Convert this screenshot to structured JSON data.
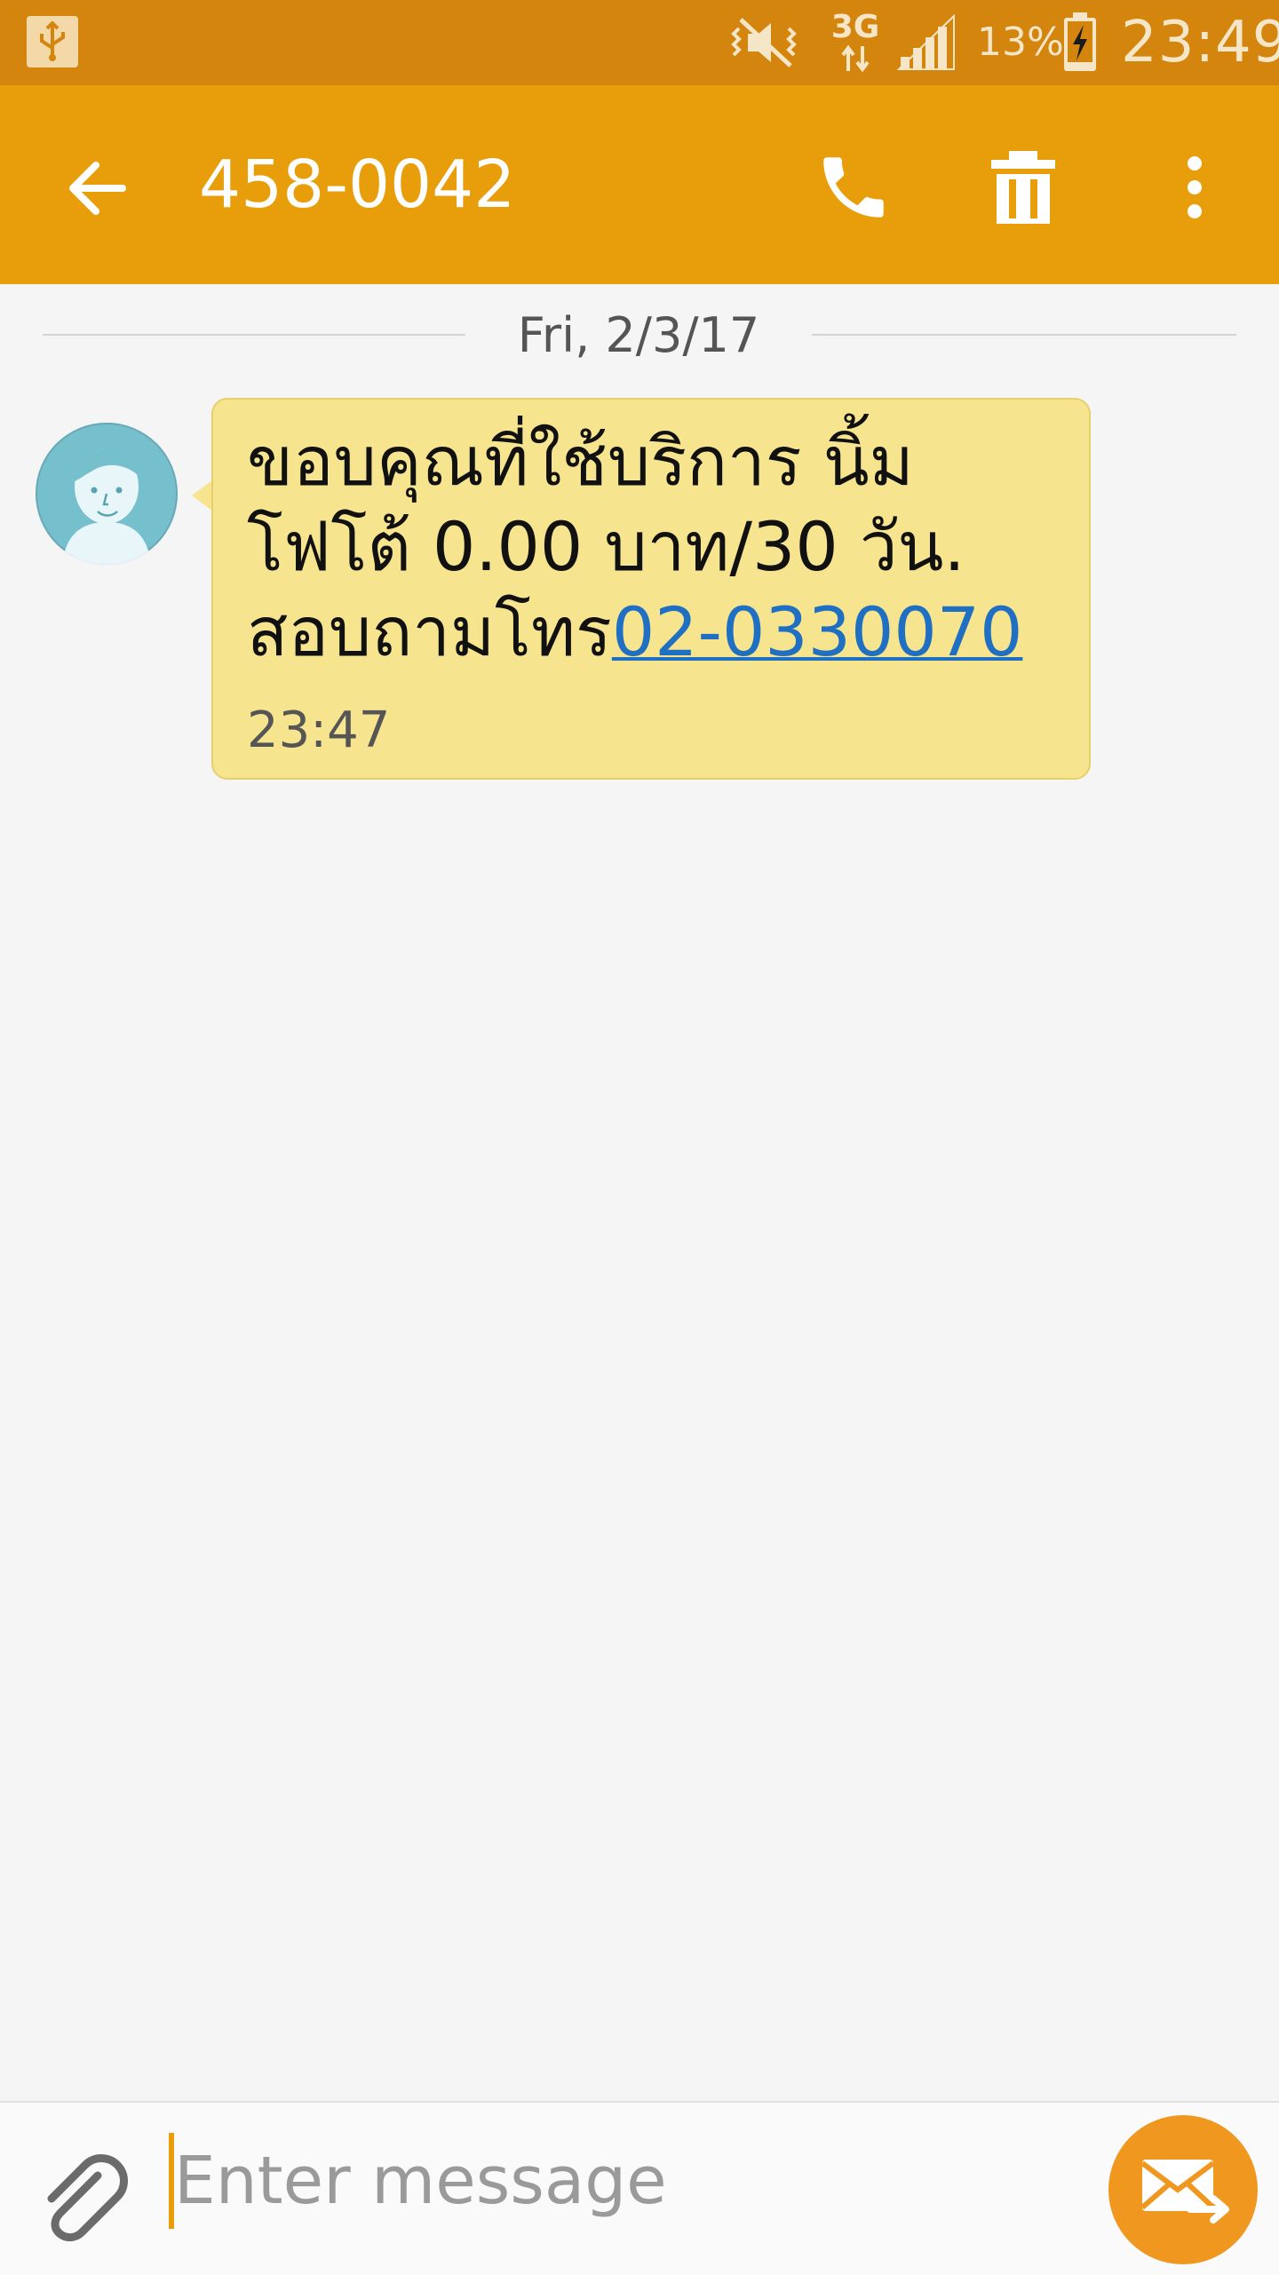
{
  "status_bar": {
    "network": "3G",
    "battery_percent": "13%",
    "time": "23:49",
    "icons": [
      "usb-icon",
      "mute-vibrate-icon",
      "network-3g-icon",
      "signal-icon",
      "battery-charging-icon"
    ]
  },
  "app_bar": {
    "contact_number": "458-0042",
    "icons": [
      "back-arrow-icon",
      "phone-icon",
      "trash-icon",
      "more-vert-icon"
    ]
  },
  "conversation": {
    "date": "Fri, 2/3/17",
    "message": {
      "line1": "ขอบคุณที่ใช้บริการ นิ้ม",
      "line2": "โฟโต้ 0.00 บาท/30 วัน.",
      "line3_prefix": "สอบถามโทร",
      "line3_link": "02-0330070",
      "time": "23:47"
    }
  },
  "composer": {
    "placeholder": "Enter message",
    "value": "",
    "icons": [
      "attach-icon",
      "send-icon"
    ]
  },
  "colors": {
    "status_bar": "#d4850e",
    "app_bar": "#e89e0b",
    "bubble": "#f6e48f",
    "link": "#1f6fc2",
    "send_button": "#ef971e"
  }
}
